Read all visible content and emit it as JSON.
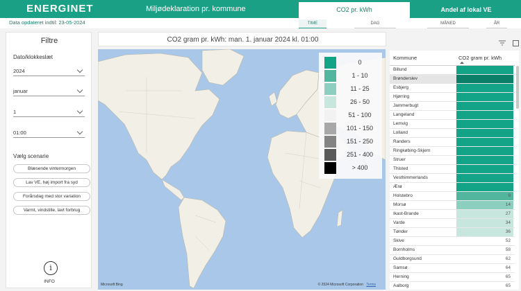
{
  "header": {
    "logo": "ENERGINET",
    "title": "Miljødeklaration pr. kommune",
    "tabs": [
      "CO2 pr. kWh",
      "Andel af lokal VE"
    ]
  },
  "updated": {
    "label": "Data opdateret indtil:",
    "date": "23-05-2024"
  },
  "periods": [
    "TIME",
    "DAG",
    "MÅNED",
    "ÅR"
  ],
  "filters": {
    "title": "Filtre",
    "date_label": "Dato/klokkeslæt",
    "year": "2024",
    "month": "januar",
    "day": "1",
    "hour": "01:00",
    "scenario_label": "Vælg scenarie",
    "scenarios": [
      "Blæsende vintermorgen",
      "Lav VE, høj import fra syd",
      "Forårsdag med stor variation",
      "Varmt, vindstille, lavt forbrug"
    ],
    "info_label": "INFO"
  },
  "map": {
    "title": "CO2 gram pr. kWh: man. 1. januar 2024 kl. 01:00",
    "attribution": "Microsoft Bing",
    "copyright": "© 2024 Microsoft Corporation",
    "terms": "Terms",
    "legend": [
      {
        "label": "0",
        "color": "#13a386"
      },
      {
        "label": "1 - 10",
        "color": "#52b69f"
      },
      {
        "label": "11 - 25",
        "color": "#8ccfbf"
      },
      {
        "label": "26 - 50",
        "color": "#c7e6dd"
      },
      {
        "label": "51 - 100",
        "color": "#f2f2f2"
      },
      {
        "label": "101 - 150",
        "color": "#a8a8a8"
      },
      {
        "label": "151 - 250",
        "color": "#848484"
      },
      {
        "label": "251 - 400",
        "color": "#5a5a5a"
      },
      {
        "label": "> 400",
        "color": "#000000"
      }
    ]
  },
  "table": {
    "col1": "Kommune",
    "col2": "CO2 gram pr. kWh",
    "rows": [
      {
        "name": "Billund",
        "value": "",
        "color": "#13a386"
      },
      {
        "name": "Brønderslev",
        "value": "",
        "color": "#0b7f68"
      },
      {
        "name": "Esbjerg",
        "value": "",
        "color": "#13a386"
      },
      {
        "name": "Hjørring",
        "value": "",
        "color": "#13a386"
      },
      {
        "name": "Jammerbugt",
        "value": "",
        "color": "#13a386"
      },
      {
        "name": "Langeland",
        "value": "",
        "color": "#13a386"
      },
      {
        "name": "Lemvig",
        "value": "",
        "color": "#13a386"
      },
      {
        "name": "Lolland",
        "value": "",
        "color": "#13a386"
      },
      {
        "name": "Randers",
        "value": "",
        "color": "#13a386"
      },
      {
        "name": "Ringkøbing-Skjern",
        "value": "",
        "color": "#13a386"
      },
      {
        "name": "Struer",
        "value": "",
        "color": "#13a386"
      },
      {
        "name": "Thisted",
        "value": "",
        "color": "#13a386"
      },
      {
        "name": "Vesthimmerlands",
        "value": "",
        "color": "#13a386"
      },
      {
        "name": "Ærø",
        "value": "",
        "color": "#13a386"
      },
      {
        "name": "Holstebro",
        "value": "9",
        "color": "#52b69f"
      },
      {
        "name": "Morsø",
        "value": "14",
        "color": "#8ccfbf"
      },
      {
        "name": "Ikast-Brande",
        "value": "27",
        "color": "#c7e6dd"
      },
      {
        "name": "Varde",
        "value": "34",
        "color": "#c7e6dd"
      },
      {
        "name": "Tønder",
        "value": "36",
        "color": "#c7e6dd"
      },
      {
        "name": "Skive",
        "value": "52",
        "color": "#ffffff"
      },
      {
        "name": "Bornholms",
        "value": "58",
        "color": "#ffffff"
      },
      {
        "name": "Guldborgsund",
        "value": "62",
        "color": "#ffffff"
      },
      {
        "name": "Samsø",
        "value": "64",
        "color": "#ffffff"
      },
      {
        "name": "Herning",
        "value": "65",
        "color": "#ffffff"
      },
      {
        "name": "Aalborg",
        "value": "65",
        "color": "#ffffff"
      }
    ]
  }
}
